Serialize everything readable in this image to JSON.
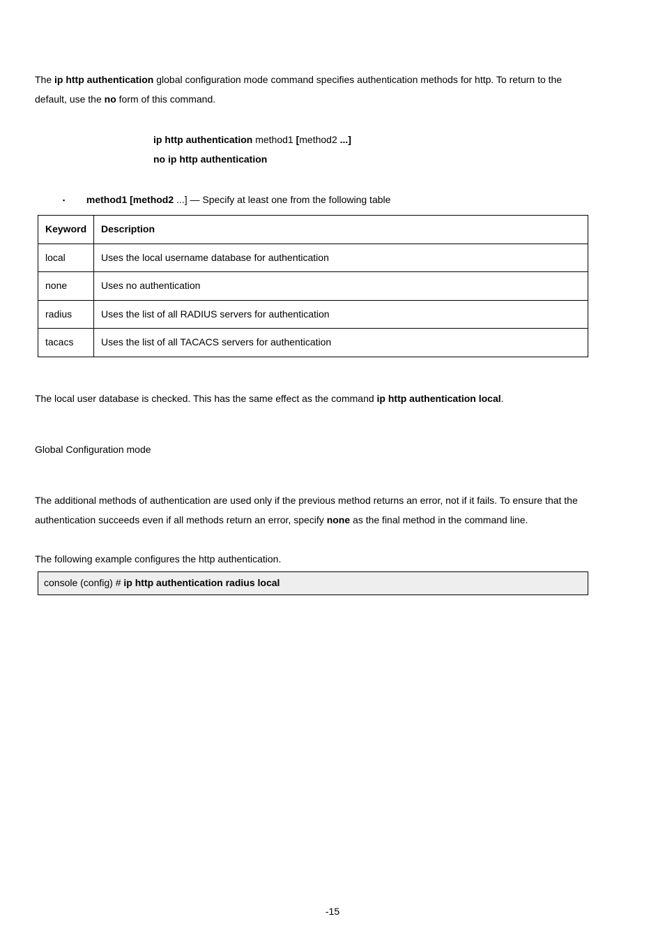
{
  "intro": {
    "line1_a": "The ",
    "line1_b": "ip http authentication",
    "line1_c": " global configuration mode command specifies authentication methods for http. To return to the",
    "line2_a": "default, use the ",
    "line2_b": "no",
    "line2_c": " form of this command."
  },
  "syntax": {
    "cmd_a": "ip http authentication ",
    "cmd_b": "method1 ",
    "cmd_c": "[",
    "cmd_d": "method2 ",
    "cmd_e": "...]",
    "no_cmd": "no ip http authentication"
  },
  "param": {
    "kw1": "method1 ",
    "kw2": "[",
    "kw3": "method2 ",
    "kw4": "...] — Specify at least one from the following table"
  },
  "table": {
    "h1": "Keyword",
    "h2": "Description",
    "rows": [
      {
        "k": "local",
        "d": "Uses the local username database for authentication"
      },
      {
        "k": "none",
        "d": "Uses no authentication"
      },
      {
        "k": "radius",
        "d": "Uses the list of all RADIUS servers for authentication"
      },
      {
        "k": "tacacs",
        "d": "Uses the list of all TACACS servers for authentication"
      }
    ]
  },
  "default_cfg": {
    "a": "The local user database is checked. This has the same effect as the command ",
    "b": "ip http authentication local",
    "c": "."
  },
  "mode": "Global Configuration mode",
  "guide": {
    "l1": "The additional methods of authentication are used only if the previous method returns an error, not if it fails. To ensure that the",
    "l2a": "authentication succeeds even if all methods return an error, specify ",
    "l2b": "none",
    "l2c": " as the final method in the command line."
  },
  "example": {
    "intro": "The following example configures the http authentication.",
    "prompt": "console (config) # ",
    "cmd": "ip http authentication radius local"
  },
  "page_no": "-15"
}
